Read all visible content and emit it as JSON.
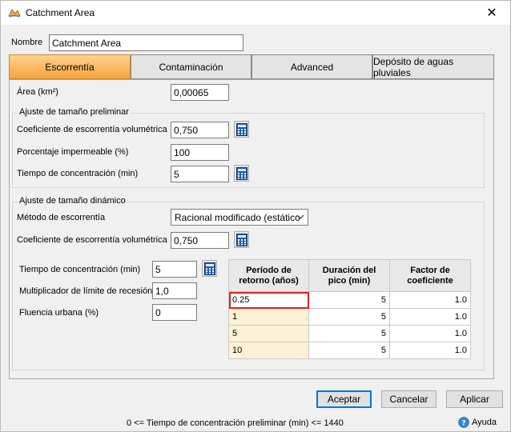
{
  "window": {
    "title": "Catchment Area",
    "close_glyph": "✕"
  },
  "name_field": {
    "label": "Nombre",
    "value": "Catchment Area"
  },
  "tabs": [
    {
      "label": "Escorrentía",
      "active": true
    },
    {
      "label": "Contaminación",
      "active": false
    },
    {
      "label": "Advanced",
      "active": false
    },
    {
      "label": "Depósito de aguas pluviales",
      "active": false
    }
  ],
  "area": {
    "label": "Área (km²)",
    "value": "0,00065"
  },
  "preliminary": {
    "title": "Ajuste de tamaño preliminar",
    "runoff_coef_label": "Coeficiente de escorrentía volumétrica",
    "runoff_coef_value": "0,750",
    "impervious_label": "Porcentaje impermeable (%)",
    "impervious_value": "100",
    "tc_label": "Tiempo de concentración (min)",
    "tc_value": "5"
  },
  "dynamic": {
    "title": "Ajuste de tamaño dinámico",
    "method_label": "Método de escorrentía",
    "method_value": "Racional modificado (estático",
    "runoff_coef_label": "Coeficiente de escorrentía volumétrica",
    "runoff_coef_value": "0,750",
    "tc_label": "Tiempo de concentración (min)",
    "tc_value": "5",
    "recession_label": "Multiplicador de límite de recesión",
    "recession_value": "1,0",
    "urban_label": "Fluencia urbana (%)",
    "urban_value": "0"
  },
  "return_table": {
    "headers": [
      "Período de retorno (años)",
      "Duración del pico (min)",
      "Factor de coeficiente"
    ],
    "rows": [
      {
        "period": "0.25",
        "duration": "5",
        "factor": "1.0"
      },
      {
        "period": "1",
        "duration": "5",
        "factor": "1.0"
      },
      {
        "period": "5",
        "duration": "5",
        "factor": "1.0"
      },
      {
        "period": "10",
        "duration": "5",
        "factor": "1.0"
      }
    ]
  },
  "buttons": {
    "accept": "Aceptar",
    "cancel": "Cancelar",
    "apply": "Aplicar"
  },
  "status_text": "0 <= Tiempo de concentración preliminar (min) <= 1440",
  "help_label": "Ayuda",
  "icons": {
    "app": "catchment-app-icon",
    "calculator": "calculator-icon",
    "help": "help-icon",
    "dropdown": "chevron-down-icon"
  },
  "colors": {
    "active_tab": "#f6a53a",
    "period_cell": "#fdf1d6",
    "selected_outline": "#e02020",
    "default_button_border": "#0078d7"
  }
}
